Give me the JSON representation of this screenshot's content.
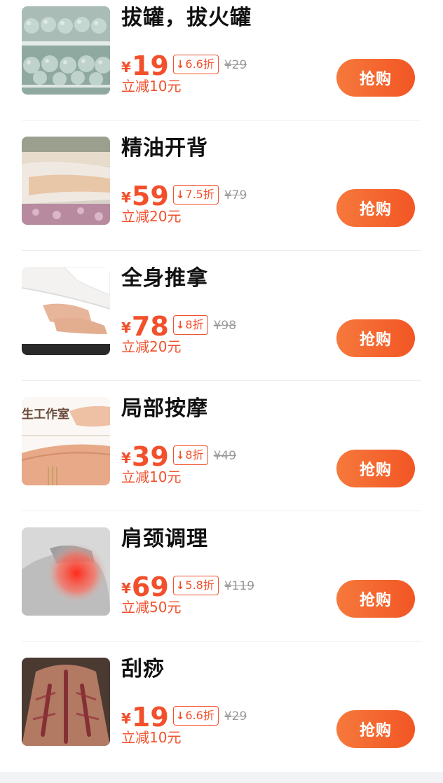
{
  "items": [
    {
      "title": "拔罐，拔火罐",
      "currency": "¥",
      "price": "19",
      "discount": "6.6折",
      "discount_arrow": "↓",
      "original_price": "¥29",
      "saving": "立减10元",
      "button": "抢购",
      "image_icon": "cupping-jars-image"
    },
    {
      "title": "精油开背",
      "currency": "¥",
      "price": "59",
      "discount": "7.5折",
      "discount_arrow": "↓",
      "original_price": "¥79",
      "saving": "立减20元",
      "button": "抢购",
      "image_icon": "oil-massage-image"
    },
    {
      "title": "全身推拿",
      "currency": "¥",
      "price": "78",
      "discount": "8折",
      "discount_arrow": "↓",
      "original_price": "¥98",
      "saving": "立减20元",
      "button": "抢购",
      "image_icon": "full-body-massage-image"
    },
    {
      "title": "局部按摩",
      "currency": "¥",
      "price": "39",
      "discount": "8折",
      "discount_arrow": "↓",
      "original_price": "¥49",
      "saving": "立减10元",
      "button": "抢购",
      "image_icon": "local-massage-image",
      "image_text": "生工作室"
    },
    {
      "title": "肩颈调理",
      "currency": "¥",
      "price": "69",
      "discount": "5.8折",
      "discount_arrow": "↓",
      "original_price": "¥119",
      "saving": "立减50元",
      "button": "抢购",
      "image_icon": "shoulder-pain-image"
    },
    {
      "title": "刮痧",
      "currency": "¥",
      "price": "19",
      "discount": "6.6折",
      "discount_arrow": "↓",
      "original_price": "¥29",
      "saving": "立减10元",
      "button": "抢购",
      "image_icon": "gua-sha-back-image"
    }
  ],
  "colors": {
    "accent": "#f2502c",
    "button_start": "#f6793c",
    "button_end": "#f25624",
    "muted": "#9a9a9a"
  }
}
